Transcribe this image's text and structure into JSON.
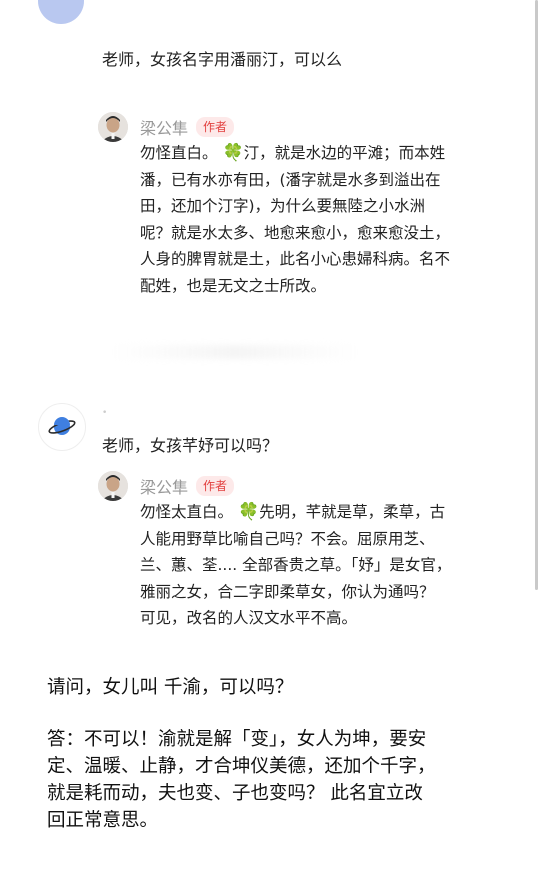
{
  "thread1": {
    "question": "老师，女孩名字用潘丽汀，可以么",
    "reply": {
      "author": "梁公隼",
      "badge": "作者",
      "lines": [
        {
          "pre": "勿怪直白。 ",
          "clover": "🍀",
          "post": "汀，就是水边的平滩；而本姓"
        },
        {
          "pre": "潘，已有水亦有田，(潘字就是水多到溢出在"
        },
        {
          "pre": "田，还加个汀字)，为什么要無陸之小水洲"
        },
        {
          "pre": "呢？就是水太多、地愈来愈小，愈来愈没土，"
        },
        {
          "pre": "人身的脾胃就是土，此名小心患婦科病。名不"
        },
        {
          "pre": "配姓，也是无文之士所改。"
        }
      ]
    }
  },
  "thread2": {
    "question": "老师，女孩芊妤可以吗？",
    "reply": {
      "author": "梁公隼",
      "badge": "作者",
      "lines": [
        {
          "pre": "勿怪太直白。 ",
          "clover": "🍀",
          "post": "先明，芊就是草，柔草，古"
        },
        {
          "pre": "人能用野草比喻自己吗？不会。屈原用芝、"
        },
        {
          "pre": "兰、蕙、荃.... 全部香贵之草。「妤」是女官，"
        },
        {
          "pre": "雅丽之女，合二字即柔草女，你认为通吗？"
        },
        {
          "pre": "可见，改名的人汉文水平不高。"
        }
      ]
    }
  },
  "post": {
    "question": "请问，女儿叫 千渝，可以吗？",
    "answer_lines": [
      "答：不可以！渝就是解「变」，女人为坤，要安",
      "定、温暖、止静，才合坤仪美德，还加个千字，",
      "就是耗而动，夫也变、子也变吗？  此名宜立改",
      "回正常意思。"
    ]
  },
  "icons": {
    "clover": "four-leaf-clover-icon",
    "planet": "planet-icon"
  },
  "colors": {
    "badge_text": "#e2403f",
    "badge_bg": "#fde9e9",
    "author_name": "#999999",
    "clover": "#3ba53b"
  }
}
